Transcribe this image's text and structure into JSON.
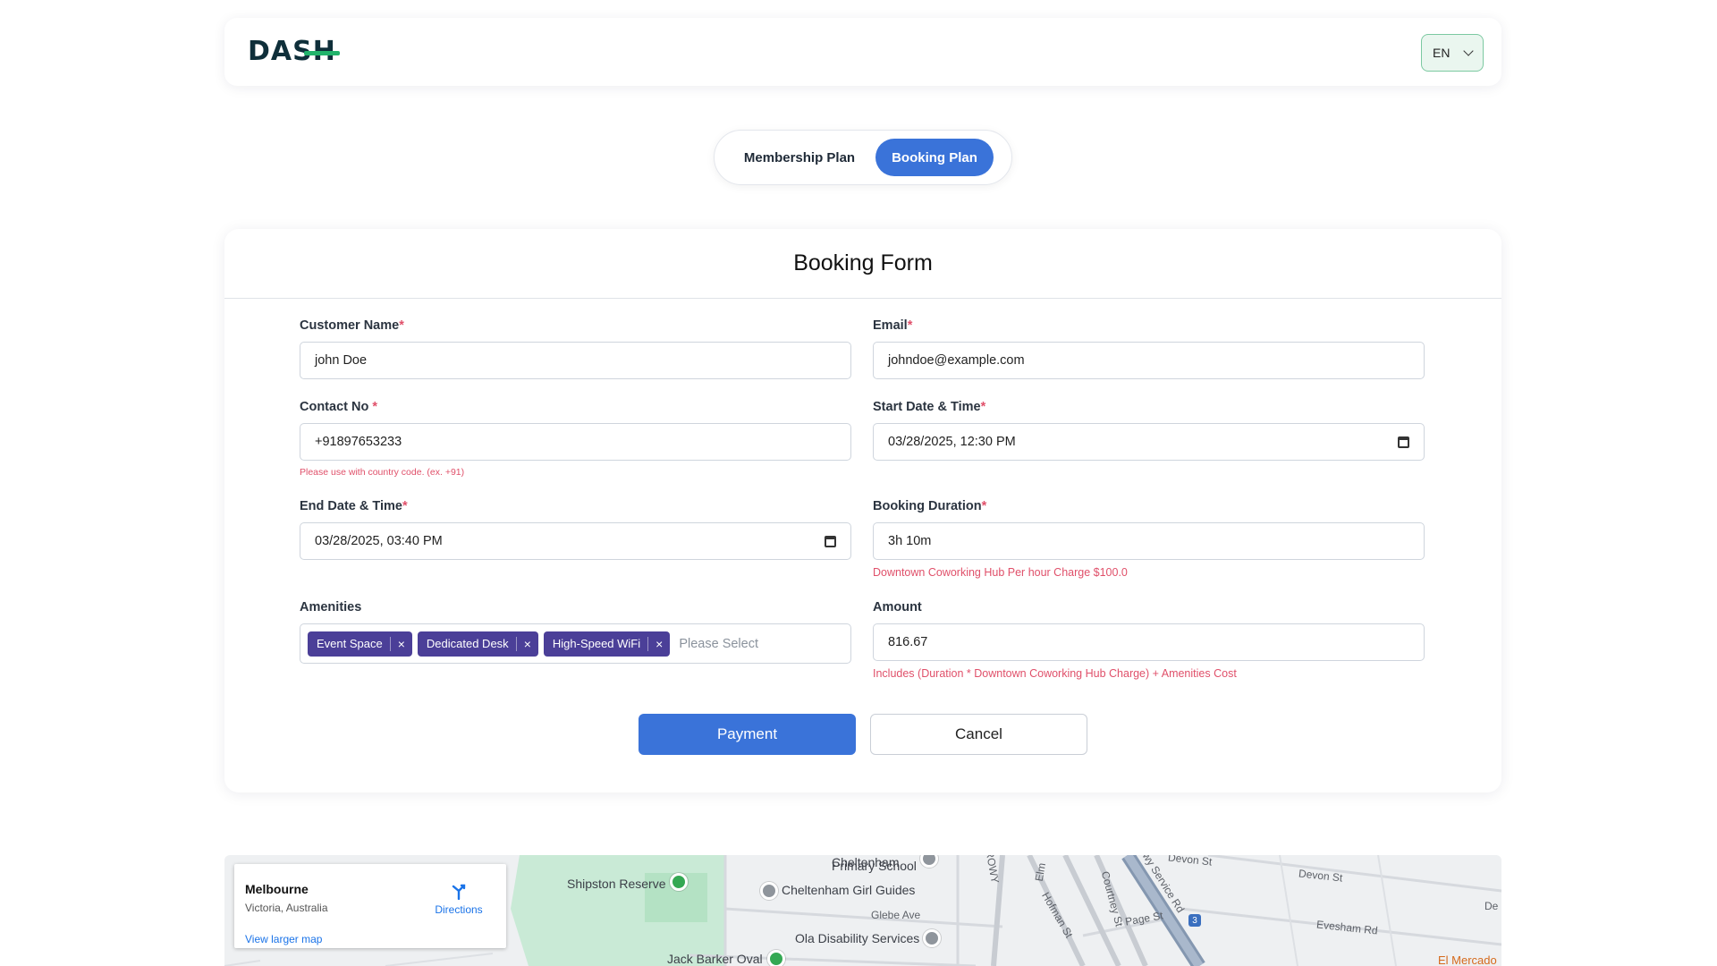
{
  "header": {
    "logo_text": "DASH",
    "language": "EN"
  },
  "plan_toggle": {
    "membership_label": "Membership Plan",
    "booking_label": "Booking Plan",
    "active": "Booking Plan"
  },
  "form": {
    "title": "Booking Form",
    "customer_name": {
      "label": "Customer Name",
      "required": "*",
      "value": "john Doe"
    },
    "email": {
      "label": "Email",
      "required": "*",
      "value": "johndoe@example.com"
    },
    "contact_no": {
      "label": "Contact No ",
      "required": "*",
      "value": "+91897653233",
      "hint": "Please use with country code. (ex. +91)"
    },
    "start_datetime": {
      "label": "Start Date & Time",
      "required": "*",
      "value": "03/28/2025, 12:30 PM"
    },
    "end_datetime": {
      "label": "End Date & Time",
      "required": "*",
      "value": "03/28/2025, 03:40 PM"
    },
    "booking_duration": {
      "label": "Booking Duration",
      "required": "*",
      "value": "3h 10m",
      "hint": "Downtown Coworking Hub Per hour Charge $100.0"
    },
    "amenities": {
      "label": "Amenities",
      "selected": [
        "Event Space",
        "Dedicated Desk",
        "High-Speed WiFi"
      ],
      "remove_glyph": "×",
      "placeholder": "Please Select"
    },
    "amount": {
      "label": "Amount",
      "value": "816.67",
      "hint": "Includes (Duration * Downtown Coworking Hub Charge) + Amenities Cost"
    },
    "payment_label": "Payment",
    "cancel_label": "Cancel"
  },
  "map": {
    "place_title": "Melbourne",
    "place_subtitle": "Victoria, Australia",
    "directions_label": "Directions",
    "view_larger_label": "View larger map",
    "labels": {
      "primary_school": "Primary School",
      "cheltenham_top": "Cheltenham",
      "shipston": "Shipston Reserve",
      "girl_guides": "Cheltenham Girl Guides",
      "glebe": "Glebe Ave",
      "ola": "Ola Disability Services",
      "jack_barker": "Jack Barker Oval",
      "el_mercado": "El Mercado",
      "devon1": "Devon St",
      "devon2": "Devon St",
      "evesham": "Evesham Rd",
      "page": "Page St",
      "hofman": "Hofman St",
      "courtney": "Courtney St",
      "service_rd": "Hwy Service Rd",
      "rowy": "ROWY",
      "elm": "Elm",
      "de": "De",
      "highway_badge": "3"
    }
  }
}
